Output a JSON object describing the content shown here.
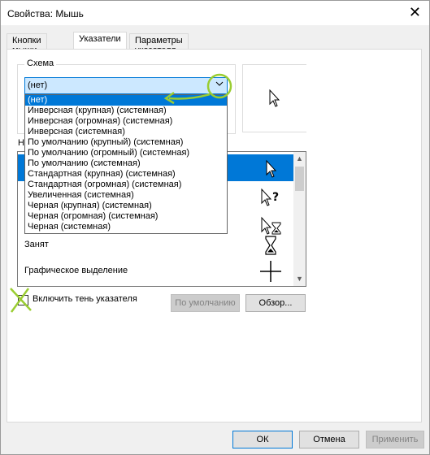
{
  "window": {
    "title": "Свойства: Мышь",
    "close_glyph": "✕"
  },
  "tabs": [
    {
      "label": "Кнопки мыши"
    },
    {
      "label": "Указатели"
    },
    {
      "label": "Параметры указателя"
    }
  ],
  "scheme": {
    "legend": "Схема",
    "selected": "(нет)",
    "options": [
      "(нет)",
      "Инверсная (крупная) (системная)",
      "Инверсная (огромная) (системная)",
      "Инверсная (системная)",
      "По умолчанию (крупный) (системная)",
      "По умолчанию (огромный) (системная)",
      "По умолчанию (системная)",
      "Стандартная (крупная) (системная)",
      "Стандартная (огромная) (системная)",
      "Увеличенная (системная)",
      "Черная (крупная) (системная)",
      "Черная (огромная) (системная)",
      "Черная (системная)"
    ]
  },
  "customize": {
    "label_fragment": "Н",
    "rows": [
      {
        "label": "",
        "icon": "arrow-cursor-icon"
      },
      {
        "label": "",
        "icon": "help-select-cursor-icon"
      },
      {
        "label": "",
        "icon": "working-background-cursor-icon"
      },
      {
        "label": "Занят",
        "icon": "busy-hourglass-icon"
      },
      {
        "label": "Графическое выделение",
        "icon": "precision-crosshair-icon"
      }
    ]
  },
  "shadow": {
    "label": "Включить тень указателя",
    "checked": false
  },
  "buttons": {
    "default_label": "По умолчанию",
    "browse_label": "Обзор...",
    "ok_label": "ОК",
    "cancel_label": "Отмена",
    "apply_label": "Применить"
  },
  "colors": {
    "selection": "#0078d7",
    "annotation": "#9acd32"
  }
}
